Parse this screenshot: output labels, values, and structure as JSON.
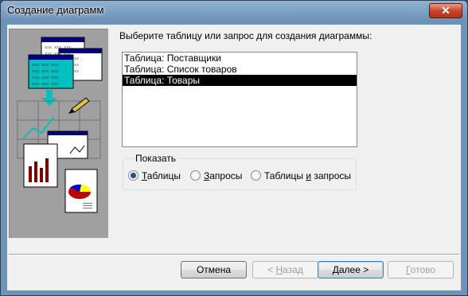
{
  "window": {
    "title": "Создание диаграмм",
    "close_icon": "close-icon"
  },
  "prompt": "Выберите таблицу или запрос для создания диаграммы:",
  "list": {
    "items": [
      "Таблица: Поставщики",
      "Таблица: Список товаров",
      "Таблица: Товары"
    ],
    "selected_index": 2
  },
  "show_group": {
    "label": "Показать",
    "options": [
      {
        "pre": "",
        "ul": "Т",
        "post": "аблицы",
        "checked": true
      },
      {
        "pre": "",
        "ul": "З",
        "post": "апросы",
        "checked": false
      },
      {
        "pre": "Таблицы ",
        "ul": "и",
        "post": " запросы",
        "checked": false
      }
    ]
  },
  "buttons": {
    "cancel": {
      "label": "Отмена"
    },
    "back": {
      "pre": "< ",
      "ul": "Н",
      "post": "азад"
    },
    "next": {
      "pre": "",
      "ul": "Д",
      "post": "алее >"
    },
    "finish": {
      "pre": "",
      "ul": "Г",
      "post": "отово"
    }
  }
}
